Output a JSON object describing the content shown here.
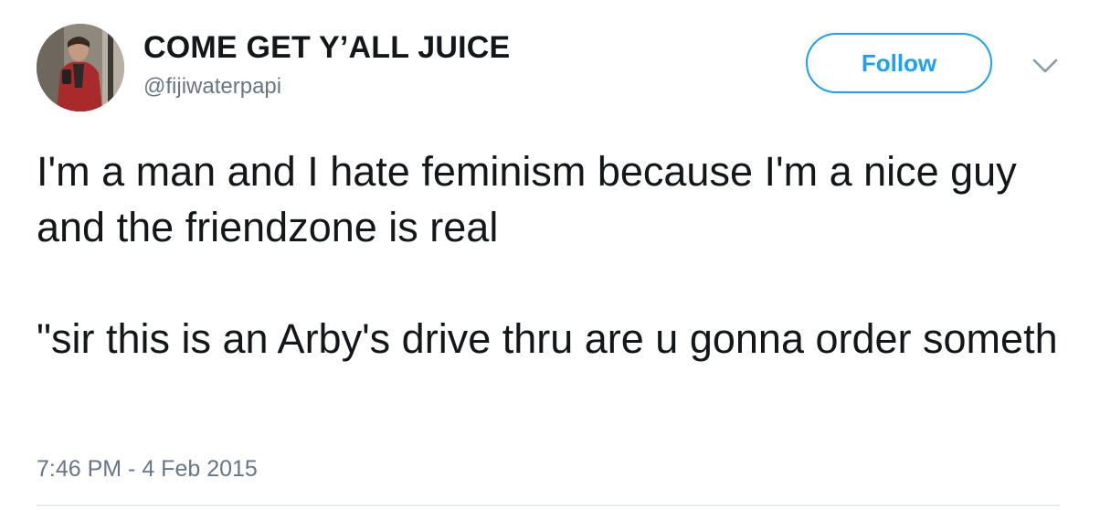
{
  "author": {
    "display_name": "COME GET Y’ALL JUICE",
    "handle": "@fijiwaterpapi"
  },
  "actions": {
    "follow_label": "Follow",
    "menu_icon": "chevron-down-icon"
  },
  "tweet": {
    "paragraphs": [
      "I'm a man and I hate feminism because I'm a nice guy and the friendzone is real",
      "\"sir this is an Arby's drive thru are u gonna order someth"
    ],
    "timestamp": "7:46 PM - 4 Feb 2015"
  },
  "colors": {
    "accent": "#1da1f2",
    "text": "#14171a",
    "secondary_text": "#657786",
    "divider": "#e6ecf0"
  }
}
